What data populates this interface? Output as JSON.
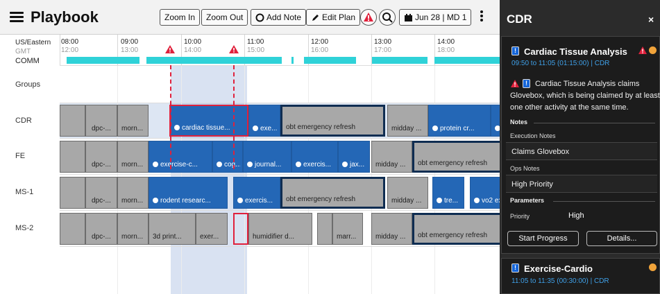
{
  "toolbar": {
    "title": "Playbook",
    "zoom_in": "Zoom In",
    "zoom_out": "Zoom Out",
    "add_note": "Add Note",
    "edit_plan": "Edit Plan",
    "date_label": "Jun 28 | MD 1"
  },
  "timezones": {
    "primary": "US/Eastern",
    "secondary": "GMT",
    "comm": "COMM",
    "hours_primary": [
      "08:00",
      "09:00",
      "10:00",
      "11:00",
      "12:00",
      "13:00",
      "14:00"
    ],
    "hours_secondary": [
      "12:00",
      "13:00",
      "14:00",
      "15:00",
      "16:00",
      "17:00",
      "18:00"
    ]
  },
  "rows": {
    "groups": "Groups",
    "cdr": "CDR",
    "fe": "FE",
    "ms1": "MS-1",
    "ms2": "MS-2"
  },
  "blocks": {
    "cdr": [
      "dpc-...",
      "morn...",
      "cardiac tissue...",
      "exe...",
      "obt emergency refresh",
      "midday ...",
      "protein cr..."
    ],
    "fe": [
      "dpc-...",
      "morn...",
      "exercise-c...",
      "cog...",
      "journal...",
      "exercis...",
      "jax...",
      "midday ...",
      "obt emergency refresh"
    ],
    "ms1": [
      "dpc-...",
      "morn...",
      "rodent researc...",
      "exercis...",
      "obt emergency refresh",
      "midday ...",
      "tre...",
      "vo2 ex"
    ],
    "ms2": [
      "dpc-...",
      "morn...",
      "3d print...",
      "exer...",
      "humidifier d...",
      "marr...",
      "midday ...",
      "obt emergency refresh"
    ]
  },
  "panel": {
    "title": "CDR",
    "close": "×",
    "card1": {
      "title": "Cardiac Tissue Analysis",
      "badge": "!",
      "time": "09:50 to 11:05 (01:15:00) | CDR",
      "conflict": "Cardiac Tissue Analysis claims Glovebox, which is being claimed by at least one other activity at the same time.",
      "notes_head": "Notes",
      "exec_label": "Execution Notes",
      "exec_value": "Claims Glovebox",
      "ops_label": "Ops Notes",
      "ops_value": "High Priority",
      "params_head": "Parameters",
      "priority_label": "Priority",
      "priority_value": "High",
      "start_btn": "Start Progress",
      "details_btn": "Details..."
    },
    "card2": {
      "title": "Exercise-Cardio",
      "badge": "!",
      "time": "11:05 to 11:35 (00:30:00) | CDR"
    }
  },
  "colors": {
    "activity_blue": "#2467b6",
    "activity_gray": "#a8a8a8",
    "conflict_red": "#e0213c",
    "comm_cyan": "#2fd2d8",
    "panel_bg": "#2b2b2b",
    "link_blue": "#3fa0e8"
  }
}
